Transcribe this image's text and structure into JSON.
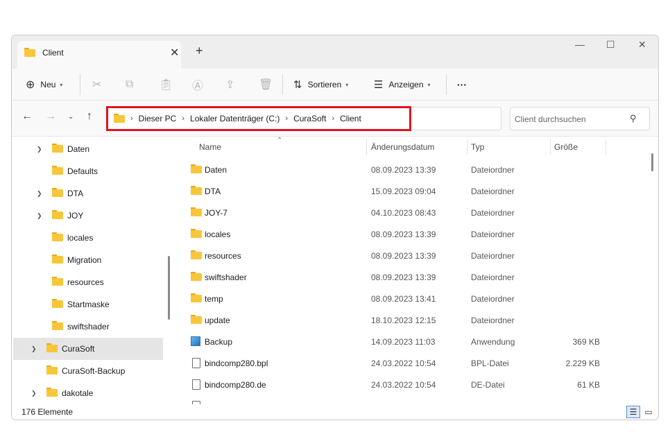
{
  "window": {
    "tab_title": "Client",
    "tab_close": "✕",
    "new_tab": "+",
    "controls": {
      "minimize": "—",
      "maximize": "☐",
      "close": "✕"
    }
  },
  "toolbar": {
    "new_label": "Neu",
    "sort_label": "Sortieren",
    "view_label": "Anzeigen",
    "more_label": "···"
  },
  "address": {
    "crumbs": [
      "Dieser PC",
      "Lokaler Datenträger (C:)",
      "CuraSoft",
      "Client"
    ],
    "search_placeholder": "Client durchsuchen"
  },
  "sidebar": {
    "items": [
      {
        "label": "Daten",
        "expandable": true
      },
      {
        "label": "Defaults",
        "expandable": false
      },
      {
        "label": "DTA",
        "expandable": true
      },
      {
        "label": "JOY",
        "expandable": true
      },
      {
        "label": "locales",
        "expandable": false
      },
      {
        "label": "Migration",
        "expandable": false
      },
      {
        "label": "resources",
        "expandable": false
      },
      {
        "label": "Startmaske",
        "expandable": false
      },
      {
        "label": "swiftshader",
        "expandable": false
      },
      {
        "label": "CuraSoft",
        "expandable": true,
        "selected": true
      },
      {
        "label": "CuraSoft-Backup",
        "expandable": false
      },
      {
        "label": "dakotale",
        "expandable": true
      }
    ]
  },
  "columns": {
    "name": "Name",
    "date": "Änderungsdatum",
    "type": "Typ",
    "size": "Größe"
  },
  "files": [
    {
      "name": "Daten",
      "date": "08.09.2023 13:39",
      "type": "Dateiordner",
      "size": "",
      "icon": "folder-icon"
    },
    {
      "name": "DTA",
      "date": "15.09.2023 09:04",
      "type": "Dateiordner",
      "size": "",
      "icon": "folder-icon"
    },
    {
      "name": "JOY-7",
      "date": "04.10.2023 08:43",
      "type": "Dateiordner",
      "size": "",
      "icon": "folder-icon"
    },
    {
      "name": "locales",
      "date": "08.09.2023 13:39",
      "type": "Dateiordner",
      "size": "",
      "icon": "folder-icon"
    },
    {
      "name": "resources",
      "date": "08.09.2023 13:39",
      "type": "Dateiordner",
      "size": "",
      "icon": "folder-icon"
    },
    {
      "name": "swiftshader",
      "date": "08.09.2023 13:39",
      "type": "Dateiordner",
      "size": "",
      "icon": "folder-icon"
    },
    {
      "name": "temp",
      "date": "08.09.2023 13:41",
      "type": "Dateiordner",
      "size": "",
      "icon": "folder-icon"
    },
    {
      "name": "update",
      "date": "18.10.2023 12:15",
      "type": "Dateiordner",
      "size": "",
      "icon": "folder-icon"
    },
    {
      "name": "Backup",
      "date": "14.09.2023 11:03",
      "type": "Anwendung",
      "size": "369 KB",
      "icon": "application-icon"
    },
    {
      "name": "bindcomp280.bpl",
      "date": "24.03.2022 10:54",
      "type": "BPL-Datei",
      "size": "2.229 KB",
      "icon": "file-icon"
    },
    {
      "name": "bindcomp280.de",
      "date": "24.03.2022 10:54",
      "type": "DE-Datei",
      "size": "61 KB",
      "icon": "file-icon"
    }
  ],
  "status": {
    "count": "176 Elemente"
  },
  "colors": {
    "highlight": "#e0141e",
    "folder": "#f8c63a",
    "selected": "#e5e5e5"
  }
}
